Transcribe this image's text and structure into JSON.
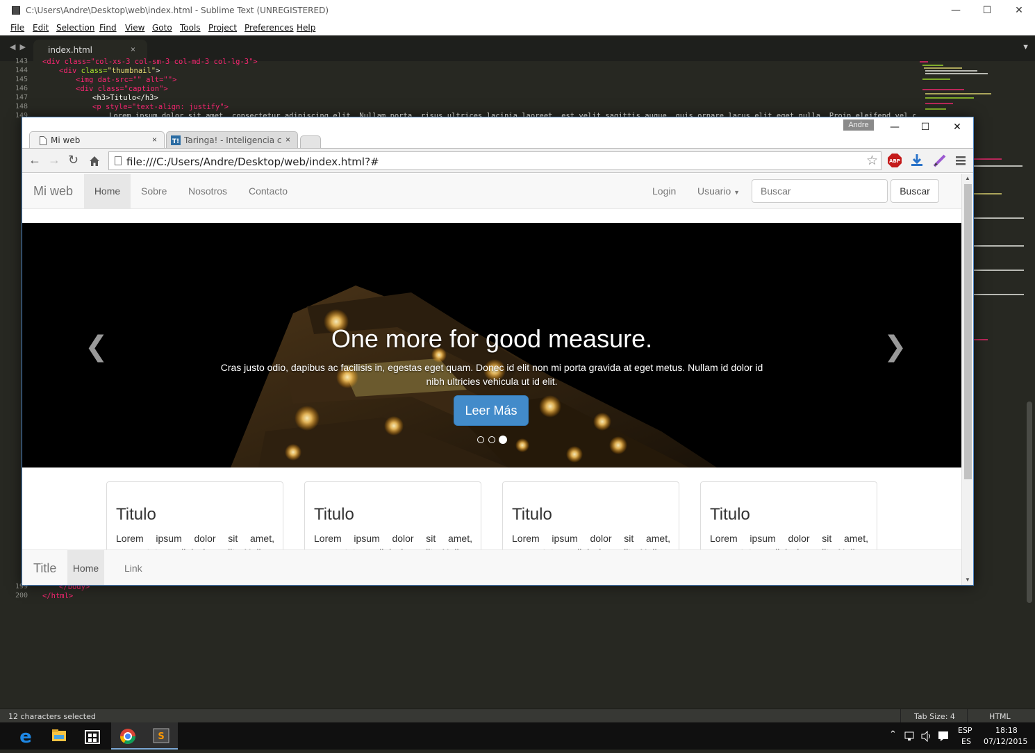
{
  "sublime": {
    "window_title": "C:\\Users\\Andre\\Desktop\\web\\index.html - Sublime Text (UNREGISTERED)",
    "menu": [
      "File",
      "Edit",
      "Selection",
      "Find",
      "View",
      "Goto",
      "Tools",
      "Project",
      "Preferences",
      "Help"
    ],
    "tab_label": "index.html",
    "tab_close": "×",
    "status_left": "12 characters selected",
    "status_tab_size": "Tab Size: 4",
    "status_syntax": "HTML",
    "line_numbers_top": [
      "143",
      "144",
      "145",
      "146",
      "147",
      "148",
      "149"
    ],
    "line_numbers_bottom": [
      "199",
      "200"
    ],
    "code": {
      "l143": "<div class=\"col-xs-3 col-sm-3 col-md-3 col-lg-3\">",
      "l144_tag": "<div",
      "l144_attr": " class=",
      "l144_str": "\"thumbnail\"",
      "l144_end": ">",
      "l145": "<img dat-src=\"\" alt=\"\">",
      "l146": "<div class=\"caption\">",
      "l147": "<h3>Titulo</h3>",
      "l148": "<p style=\"text-align: justify\">",
      "l149": "Lorem ipsum dolor sit amet, consectetur adipiscing elit. Nullam porta, risus ultrices lacinia laoreet, est velit sagittis augue, quis ornare lacus elit eget nulla. Proin eleifend vel diam in",
      "l199": "</body>",
      "l200": "</html>"
    }
  },
  "chrome": {
    "user_badge": "Andre",
    "tabs": [
      {
        "label": "Mi web",
        "close": "×"
      },
      {
        "label": "Taringa! - Inteligencia cole",
        "close": "×"
      }
    ],
    "url": "file:///C:/Users/Andre/Desktop/web/index.html?#",
    "ext_abp": "ABP"
  },
  "page": {
    "brand": "Mi web",
    "nav": [
      "Home",
      "Sobre",
      "Nosotros",
      "Contacto"
    ],
    "nav_right": {
      "login": "Login",
      "usuario": "Usuario"
    },
    "search_placeholder": "Buscar",
    "search_button": "Buscar",
    "carousel": {
      "heading": "One more for good measure.",
      "text": "Cras justo odio, dapibus ac facilisis in, egestas eget quam. Donec id elit non mi porta gravida at eget metus. Nullam id dolor id nibh ultricies vehicula ut id elit.",
      "button": "Leer Más",
      "active_slide": 3,
      "slide_count": 3
    },
    "thumbnails": [
      {
        "title": "Titulo",
        "text": "Lorem ipsum dolor sit amet, consectetur adipiscing elit. Nullam"
      },
      {
        "title": "Titulo",
        "text": "Lorem ipsum dolor sit amet, consectetur adipiscing elit. Nullam"
      },
      {
        "title": "Titulo",
        "text": "Lorem ipsum dolor sit amet, consectetur adipiscing elit. Nullam"
      },
      {
        "title": "Titulo",
        "text": "Lorem ipsum dolor sit amet, consectetur adipiscing elit. Nullam"
      }
    ],
    "bottom_nav": {
      "title": "Title",
      "home": "Home",
      "link": "Link"
    }
  },
  "taskbar": {
    "lang_top": "ESP",
    "lang_bottom": "ES",
    "time": "18:18",
    "date": "07/12/2015"
  },
  "colors": {
    "editor_bg": "#272822",
    "bootstrap_primary": "#428bca",
    "chrome_border": "#4e86c4"
  }
}
